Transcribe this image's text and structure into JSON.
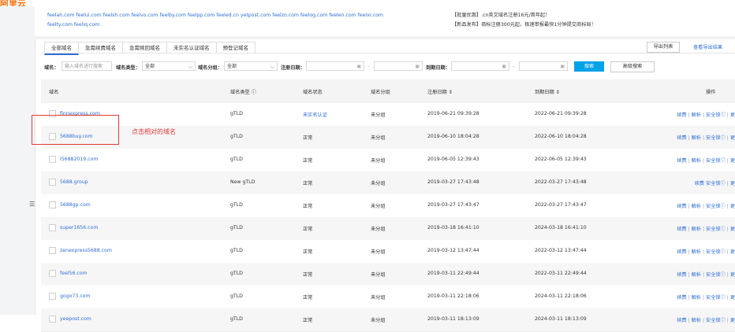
{
  "header": {
    "logo_text": "阿里云"
  },
  "suffix_line1": "feelah.com feelui.com feelsh.com feelvo.com feelby.com feelpp.com feeled.cn yetpost.com feelzo.com feelog.com feelen.com feelxr.com",
  "suffix_line2": "feelty.com feeliq.com",
  "notices": [
    "【批量优惠】.cn英文域名注册16元/首年起！",
    "【新品发布】商标注册300元起，极速审报最快1分钟提交商标局！"
  ],
  "tabs": [
    "全部域名",
    "急需续费域名",
    "急需赎回域名",
    "未实名认证域名",
    "预登记域名"
  ],
  "actions": {
    "export_list": "导出列表",
    "view_export": "查看导出结果"
  },
  "filters": {
    "domain_label": "域名：",
    "domain_placeholder": "输入域名进行搜索",
    "type_label": "域名类型：",
    "type_value": "全部",
    "group_label": "域名分组：",
    "group_value": "全部",
    "reg_label": "注册日期：",
    "exp_label": "到期日期：",
    "dash": "-",
    "search": "搜索",
    "advanced": "高级搜索"
  },
  "columns": {
    "domain": "域名",
    "type": "域名类型 ⓘ",
    "status": "域名状态",
    "group": "域名分组",
    "reg": "注册日期 ⇕",
    "exp": "到期日期 ⇕",
    "ops": "操作"
  },
  "ops": {
    "renew": "续费",
    "bar": "|",
    "resolve": "解析",
    "security": "安全锁ⓘ",
    "more": "更"
  },
  "rows": [
    {
      "domain": "finnexpress.com",
      "type": "gTLD",
      "status": "未实名认证",
      "group": "未分组",
      "reg": "2019-06-21 09:39:28",
      "exp": "2022-06-21 09:39:28"
    },
    {
      "domain": "5688buy.com",
      "type": "gTLD",
      "status": "正常",
      "group": "未分组",
      "reg": "2019-06-10 18:04:28",
      "exp": "2022-06-10 18:04:28"
    },
    {
      "domain": "i56882019.com",
      "type": "gTLD",
      "status": "正常",
      "group": "未分组",
      "reg": "2019-06-05 12:39:43",
      "exp": "2022-06-05 12:39:43"
    },
    {
      "domain": "5688.group",
      "type": "New gTLD",
      "status": "正常",
      "group": "未分组",
      "reg": "2019-03-27 17:43:48",
      "exp": "2022-03-27 17:43:48"
    },
    {
      "domain": "5688gp.com",
      "type": "gTLD",
      "status": "正常",
      "group": "未分组",
      "reg": "2019-03-27 17:43:47",
      "exp": "2022-03-27 17:43:47"
    },
    {
      "domain": "super1656.com",
      "type": "gTLD",
      "status": "正常",
      "group": "未分组",
      "reg": "2019-03-18 16:41:10",
      "exp": "2024-03-18 16:41:10"
    },
    {
      "domain": "zenexpress5688.com",
      "type": "gTLD",
      "status": "正常",
      "group": "未分组",
      "reg": "2019-03-12 13:47:44",
      "exp": "2022-03-12 13:47:44"
    },
    {
      "domain": "feel56.com",
      "type": "gTLD",
      "status": "正常",
      "group": "未分组",
      "reg": "2019-03-11 22:49:44",
      "exp": "2022-03-11 22:49:44"
    },
    {
      "domain": "gogo73.com",
      "type": "gTLD",
      "status": "正常",
      "group": "未分组",
      "reg": "2019-03-11 22:18:06",
      "exp": "2024-03-11 22:18:06"
    },
    {
      "domain": "yeepost.com",
      "type": "gTLD",
      "status": "正常",
      "group": "未分组",
      "reg": "2019-03-11 18:13:09",
      "exp": "2024-03-11 18:13:09"
    }
  ],
  "annotation": {
    "text": "点击相对的域名",
    "color": "#e53935"
  },
  "colors": {
    "accent": "#2f6fd6",
    "search_button": "#00a2e8",
    "brand": "#ff6a00"
  }
}
